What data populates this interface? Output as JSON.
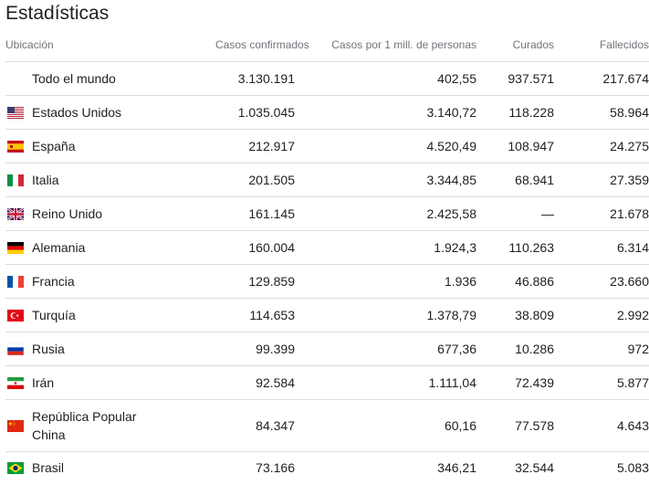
{
  "title": "Estadísticas",
  "headers": {
    "location": "Ubicación",
    "cases": "Casos confirmados",
    "per_million": "Casos por 1 mill. de personas",
    "cured": "Curados",
    "deaths": "Fallecidos"
  },
  "rows": [
    {
      "name": "Todo el mundo",
      "flag": "none",
      "cases": "3.130.191",
      "per_million": "402,55",
      "cured": "937.571",
      "deaths": "217.674"
    },
    {
      "name": "Estados Unidos",
      "flag": "us-flag",
      "cases": "1.035.045",
      "per_million": "3.140,72",
      "cured": "118.228",
      "deaths": "58.964"
    },
    {
      "name": "España",
      "flag": "es-flag",
      "cases": "212.917",
      "per_million": "4.520,49",
      "cured": "108.947",
      "deaths": "24.275"
    },
    {
      "name": "Italia",
      "flag": "it-flag",
      "cases": "201.505",
      "per_million": "3.344,85",
      "cured": "68.941",
      "deaths": "27.359"
    },
    {
      "name": "Reino Unido",
      "flag": "uk-flag",
      "cases": "161.145",
      "per_million": "2.425,58",
      "cured": "—",
      "deaths": "21.678"
    },
    {
      "name": "Alemania",
      "flag": "de-flag",
      "cases": "160.004",
      "per_million": "1.924,3",
      "cured": "110.263",
      "deaths": "6.314"
    },
    {
      "name": "Francia",
      "flag": "fr-flag",
      "cases": "129.859",
      "per_million": "1.936",
      "cured": "46.886",
      "deaths": "23.660"
    },
    {
      "name": "Turquía",
      "flag": "tr-flag",
      "cases": "114.653",
      "per_million": "1.378,79",
      "cured": "38.809",
      "deaths": "2.992"
    },
    {
      "name": "Rusia",
      "flag": "ru-flag",
      "cases": "99.399",
      "per_million": "677,36",
      "cured": "10.286",
      "deaths": "972"
    },
    {
      "name": "Irán",
      "flag": "ir-flag",
      "cases": "92.584",
      "per_million": "1.111,04",
      "cured": "72.439",
      "deaths": "5.877"
    },
    {
      "name": "República Popular China",
      "flag": "cn-flag",
      "cases": "84.347",
      "per_million": "60,16",
      "cured": "77.578",
      "deaths": "4.643"
    },
    {
      "name": "Brasil",
      "flag": "br-flag",
      "cases": "73.166",
      "per_million": "346,21",
      "cured": "32.544",
      "deaths": "5.083"
    }
  ]
}
